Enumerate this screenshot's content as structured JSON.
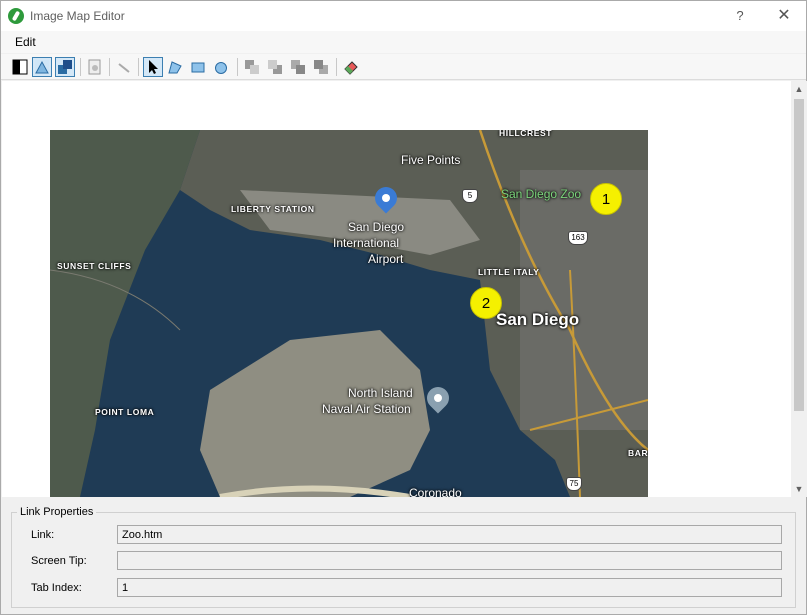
{
  "window": {
    "title": "Image Map Editor",
    "help_symbol": "?",
    "close_symbol": "✕"
  },
  "menu": {
    "edit": "Edit"
  },
  "toolbar": {
    "buttons": [
      {
        "name": "contrast-icon",
        "active": false
      },
      {
        "name": "polygon-highlight-icon",
        "active": true
      },
      {
        "name": "rectangle-overlap-icon",
        "active": true
      },
      {
        "name": "properties-icon",
        "active": false
      },
      {
        "name": "unlink-icon",
        "active": false
      },
      {
        "name": "pointer-icon",
        "active": true
      },
      {
        "name": "polygon-tool-icon",
        "active": false
      },
      {
        "name": "rectangle-tool-icon",
        "active": false
      },
      {
        "name": "circle-tool-icon",
        "active": false
      },
      {
        "name": "bring-forward-icon",
        "active": false
      },
      {
        "name": "send-backward-icon",
        "active": false
      },
      {
        "name": "bring-to-front-icon",
        "active": false
      },
      {
        "name": "send-to-back-icon",
        "active": false
      },
      {
        "name": "eraser-icon",
        "active": false
      }
    ]
  },
  "map": {
    "labels": {
      "hillcrest": "HILLCREST",
      "five_points": "Five Points",
      "san_diego_zoo": "San Diego Zoo",
      "liberty_station": "LIBERTY STATION",
      "airport_line1": "San Diego",
      "airport_line2": "International",
      "airport_line3": "Airport",
      "sunset_cliffs": "SUNSET CLIFFS",
      "little_italy": "LITTLE ITALY",
      "san_diego": "San Diego",
      "north_island_line1": "North Island",
      "north_island_line2": "Naval Air Station",
      "point_loma": "POINT LOMA",
      "coronado": "Coronado",
      "bar": "BAR",
      "route_5": "5",
      "route_163": "163",
      "route_75": "75"
    },
    "hotspots": [
      {
        "number": "1",
        "link": "Zoo.htm"
      },
      {
        "number": "2",
        "link": ""
      }
    ]
  },
  "link_properties": {
    "legend": "Link Properties",
    "link_label": "Link:",
    "link_value": "Zoo.htm",
    "screen_tip_label": "Screen Tip:",
    "screen_tip_value": "",
    "tab_index_label": "Tab Index:",
    "tab_index_value": "1"
  },
  "colors": {
    "hotspot": "#f5f000",
    "selection": "#3c7fb1",
    "water": "#1e3a54"
  }
}
